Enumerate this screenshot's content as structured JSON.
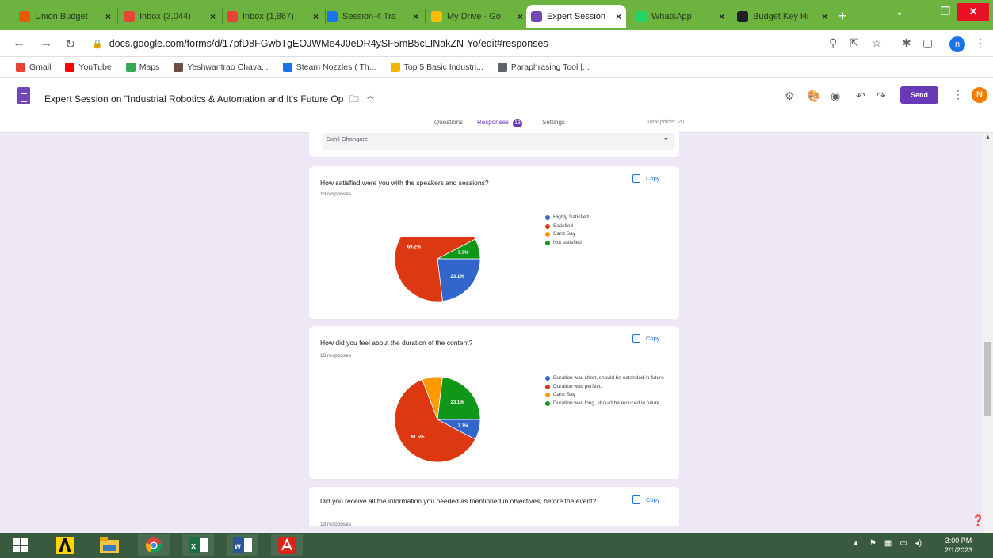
{
  "browser": {
    "tabs": [
      {
        "title": "Union Budget",
        "icon": "budget-icon",
        "color": "#e8590c"
      },
      {
        "title": "Inbox (3,044)",
        "icon": "gmail-icon",
        "color": "#ea4335"
      },
      {
        "title": "Inbox (1,867)",
        "icon": "gmail-icon",
        "color": "#ea4335"
      },
      {
        "title": "Session-4 Tra",
        "icon": "doc-icon",
        "color": "#1a73e8"
      },
      {
        "title": "My Drive - Go",
        "icon": "drive-icon",
        "color": "#fbbc04"
      },
      {
        "title": "Expert Session",
        "icon": "forms-icon",
        "color": "#7248b9"
      },
      {
        "title": "WhatsApp",
        "icon": "whatsapp-icon",
        "color": "#25d366"
      },
      {
        "title": "Budget Key Hi",
        "icon": "doc-icon",
        "color": "#202124"
      }
    ],
    "close_glyph": "×",
    "new_tab_glyph": "+",
    "url": "docs.google.com/forms/d/17pfD8FGwbTgEOJWMe4J0eDR4ySF5mB5cLINakZN-Yo/edit#responses",
    "profile_initial": "n",
    "bookmarks": [
      {
        "label": "Gmail",
        "color": "#ea4335"
      },
      {
        "label": "YouTube",
        "color": "#ff0000"
      },
      {
        "label": "Maps",
        "color": "#34a853"
      },
      {
        "label": "Yeshwantrao Chava...",
        "color": "#6d4c41"
      },
      {
        "label": "Steam Nozzles ( Th...",
        "color": "#1a73e8"
      },
      {
        "label": "Top 5 Basic Industri...",
        "color": "#f4b400"
      },
      {
        "label": "Paraphrasing Tool |...",
        "color": "#5f6368"
      }
    ]
  },
  "form": {
    "title": "Expert Session  on \"Industrial Robotics & Automation and It's Future Op",
    "send_label": "Send",
    "user_initial": "N",
    "tabs": {
      "questions": "Questions",
      "responses": "Responses",
      "responses_count": "13",
      "settings": "Settings"
    },
    "total_points": "Total points: 20"
  },
  "dropdown_card": {
    "value": "Sahil Ghangare"
  },
  "questions": [
    {
      "question": "How satisfied were you with the speakers and sessions?",
      "responses": "13 responses",
      "copy_label": "Copy",
      "legend": [
        {
          "label": "Highly Satisfied",
          "color": "#3366cc"
        },
        {
          "label": "Satisfied",
          "color": "#dc3912"
        },
        {
          "label": "Can't Say",
          "color": "#ff9900"
        },
        {
          "label": "Not satisfied",
          "color": "#109618"
        }
      ],
      "slices": [
        {
          "label": "23.1%",
          "value": 23.1,
          "color": "#3366cc"
        },
        {
          "label": "69.2%",
          "value": 69.2,
          "color": "#dc3912"
        },
        {
          "label": "",
          "value": 0,
          "color": "#ff9900"
        },
        {
          "label": "7.7%",
          "value": 7.7,
          "color": "#109618"
        }
      ]
    },
    {
      "question": "How did you feel about the duration of the content?",
      "responses": "13 responses",
      "copy_label": "Copy",
      "legend": [
        {
          "label": "Duration was short, should be extended in future",
          "color": "#3366cc"
        },
        {
          "label": "Duration was perfect.",
          "color": "#dc3912"
        },
        {
          "label": "Can't Say",
          "color": "#ff9900"
        },
        {
          "label": "Duration was long, should be reduced in future.",
          "color": "#109618"
        }
      ],
      "slices": [
        {
          "label": "7.7%",
          "value": 7.7,
          "color": "#3366cc"
        },
        {
          "label": "61.5%",
          "value": 61.5,
          "color": "#dc3912"
        },
        {
          "label": "",
          "value": 7.7,
          "color": "#ff9900"
        },
        {
          "label": "23.1%",
          "value": 23.1,
          "color": "#109618"
        }
      ]
    },
    {
      "question": "Did you receive all the information you needed as mentioned in objectives, before the event?",
      "responses": "13 responses",
      "copy_label": "Copy"
    }
  ],
  "taskbar": {
    "apps": [
      "windows-start",
      "norton-app",
      "file-explorer",
      "chrome",
      "excel",
      "word",
      "acrobat"
    ],
    "time": "3:00 PM",
    "date": "2/1/2023"
  }
}
